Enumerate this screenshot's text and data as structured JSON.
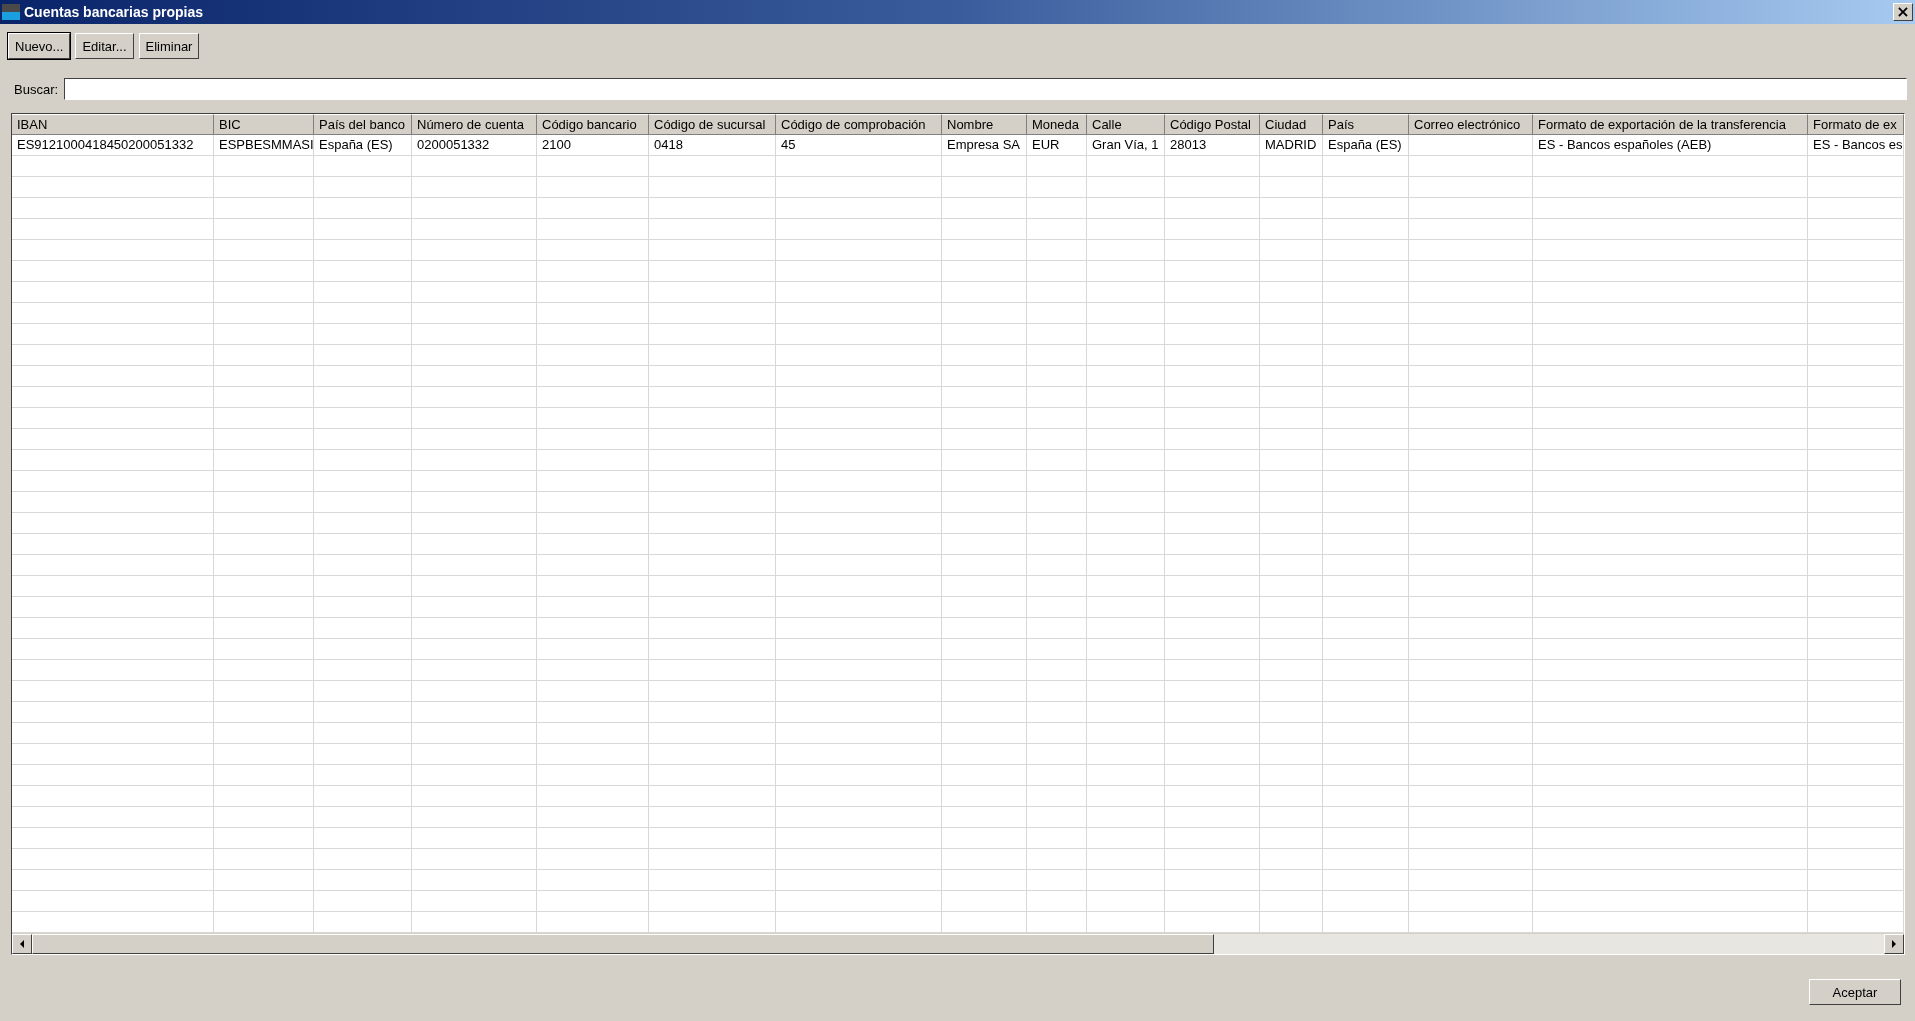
{
  "window": {
    "title": "Cuentas bancarias propias",
    "close": "×"
  },
  "toolbar": [
    {
      "label": "Nuevo...",
      "default": true
    },
    {
      "label": "Editar...",
      "default": false
    },
    {
      "label": "Eliminar",
      "default": false
    }
  ],
  "search": {
    "label": "Buscar:"
  },
  "table": {
    "columns": [
      "IBAN",
      "BIC",
      "País del banco",
      "Número de cuenta",
      "Código bancario",
      "Código de sucursal",
      "Código de comprobación",
      "Nombre",
      "Moneda",
      "Calle",
      "Código Postal",
      "Ciudad",
      "País",
      "Correo electrónico",
      "Formato de exportación de la transferencia",
      "Formato de ex"
    ],
    "rows": [
      [
        "ES9121000418450200051332",
        "ESPBESMMASI",
        "España (ES)",
        "0200051332",
        "2100",
        "0418",
        "45",
        "Empresa SA",
        "EUR",
        "Gran Vía, 1",
        "28013",
        "MADRID",
        "España (ES)",
        "",
        "ES - Bancos españoles (AEB)",
        "ES - Bancos es"
      ]
    ]
  },
  "buttons": [
    {
      "label": "Aceptar"
    }
  ]
}
